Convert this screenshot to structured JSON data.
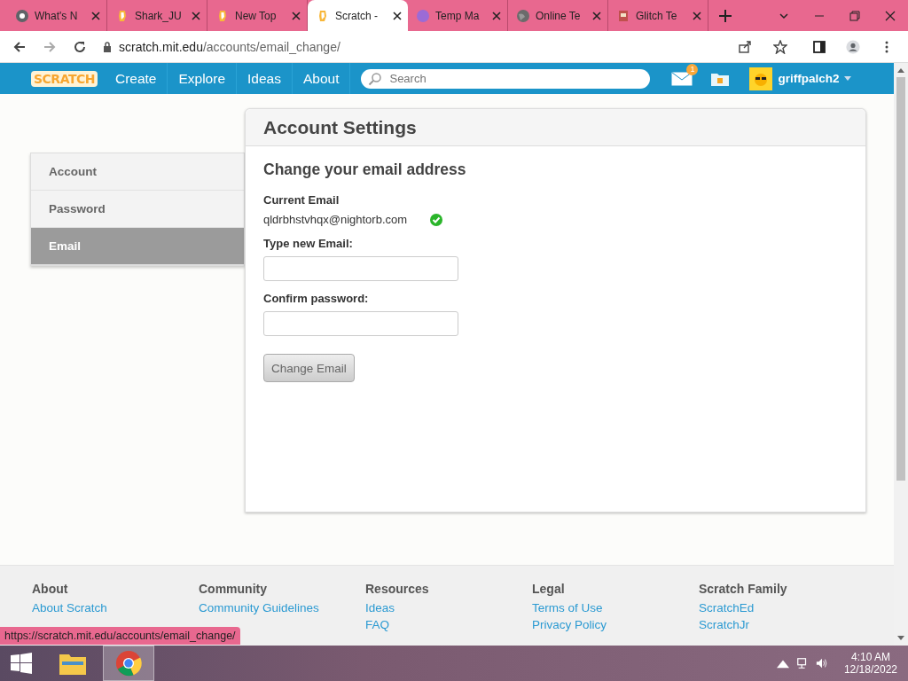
{
  "browser": {
    "tabs": [
      {
        "title": "What's N",
        "kind": "chrome",
        "selected": false
      },
      {
        "title": "Shark_JU",
        "kind": "scratch",
        "selected": false
      },
      {
        "title": "New Top",
        "kind": "scratch",
        "selected": false
      },
      {
        "title": "Scratch -",
        "kind": "scratch",
        "selected": true
      },
      {
        "title": "Temp Ma",
        "kind": "purple",
        "selected": false
      },
      {
        "title": "Online Te",
        "kind": "globe",
        "selected": false
      },
      {
        "title": "Glitch Te",
        "kind": "book",
        "selected": false
      }
    ],
    "url_host": "scratch.mit.edu",
    "url_path": "/accounts/email_change/"
  },
  "nav": {
    "logo": "SCRATCH",
    "items": [
      "Create",
      "Explore",
      "Ideas",
      "About"
    ],
    "search": {
      "placeholder": "Search"
    },
    "messages_count": "1",
    "username": "griffpalch2"
  },
  "sidebar": {
    "items": [
      {
        "label": "Account",
        "selected": false
      },
      {
        "label": "Password",
        "selected": false
      },
      {
        "label": "Email",
        "selected": true
      }
    ]
  },
  "settings": {
    "title": "Account Settings",
    "heading": "Change your email address",
    "current_label": "Current Email",
    "current_email": "qldrbhstvhqx@nightorb.com",
    "verified": true,
    "fields": [
      {
        "label": "Type new Email:"
      },
      {
        "label": "Confirm password:"
      }
    ],
    "button": "Change Email"
  },
  "footer": {
    "columns": [
      {
        "title": "About",
        "links": [
          "About Scratch"
        ]
      },
      {
        "title": "Community",
        "links": [
          "Community Guidelines"
        ]
      },
      {
        "title": "Resources",
        "links": [
          "Ideas",
          "FAQ"
        ]
      },
      {
        "title": "Legal",
        "links": [
          "Terms of Use",
          "Privacy Policy"
        ]
      },
      {
        "title": "Scratch Family",
        "links": [
          "ScratchEd",
          "ScratchJr"
        ]
      }
    ]
  },
  "status_url": "https://scratch.mit.edu/accounts/email_change/",
  "taskbar": {
    "time": "4:10 AM",
    "date": "12/18/2022"
  }
}
